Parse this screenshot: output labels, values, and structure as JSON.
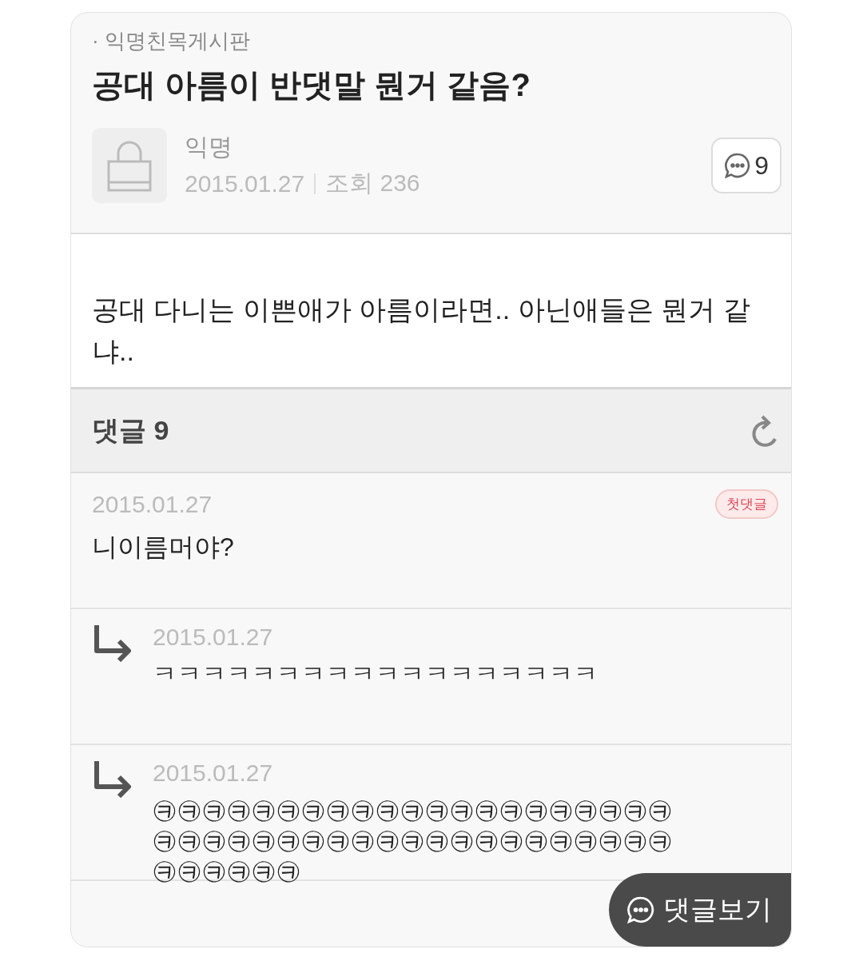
{
  "board": "· 익명친목게시판",
  "post": {
    "title": "공대 아름이 반댓말 뭔거 같음?",
    "author": "익명",
    "date": "2015.01.27",
    "views": "조회 236",
    "comment_count": "9",
    "body_lines": [
      "공대 다니는 이쁜애가 아름이라면.. 아닌애들은 뭔거 같",
      "냐.."
    ]
  },
  "comments_header": {
    "label": "댓글",
    "count": "9"
  },
  "comments": [
    {
      "kind": "comment",
      "date": "2015.01.27",
      "badge": "첫댓글",
      "lines": [
        "니이름머야?"
      ]
    },
    {
      "kind": "reply",
      "date": "2015.01.27",
      "lines": [
        "ㅋㅋㅋㅋㅋㅋㅋㅋㅋㅋㅋㅋㅋㅋㅋㅋㅋㅋ"
      ]
    },
    {
      "kind": "reply",
      "date": "2015.01.27",
      "lines": [
        "㉪㉪㉪㉪㉪㉪㉪㉪㉪㉪㉪㉪㉪㉪㉪㉪㉪㉪㉪㉪㉪",
        "㉪㉪㉪㉪㉪㉪㉪㉪㉪㉪㉪㉪㉪㉪㉪㉪㉪㉪㉪㉪㉪",
        "㉪㉪㉪㉪㉪㉪"
      ]
    }
  ],
  "floating_button": {
    "label": "댓글보기"
  }
}
